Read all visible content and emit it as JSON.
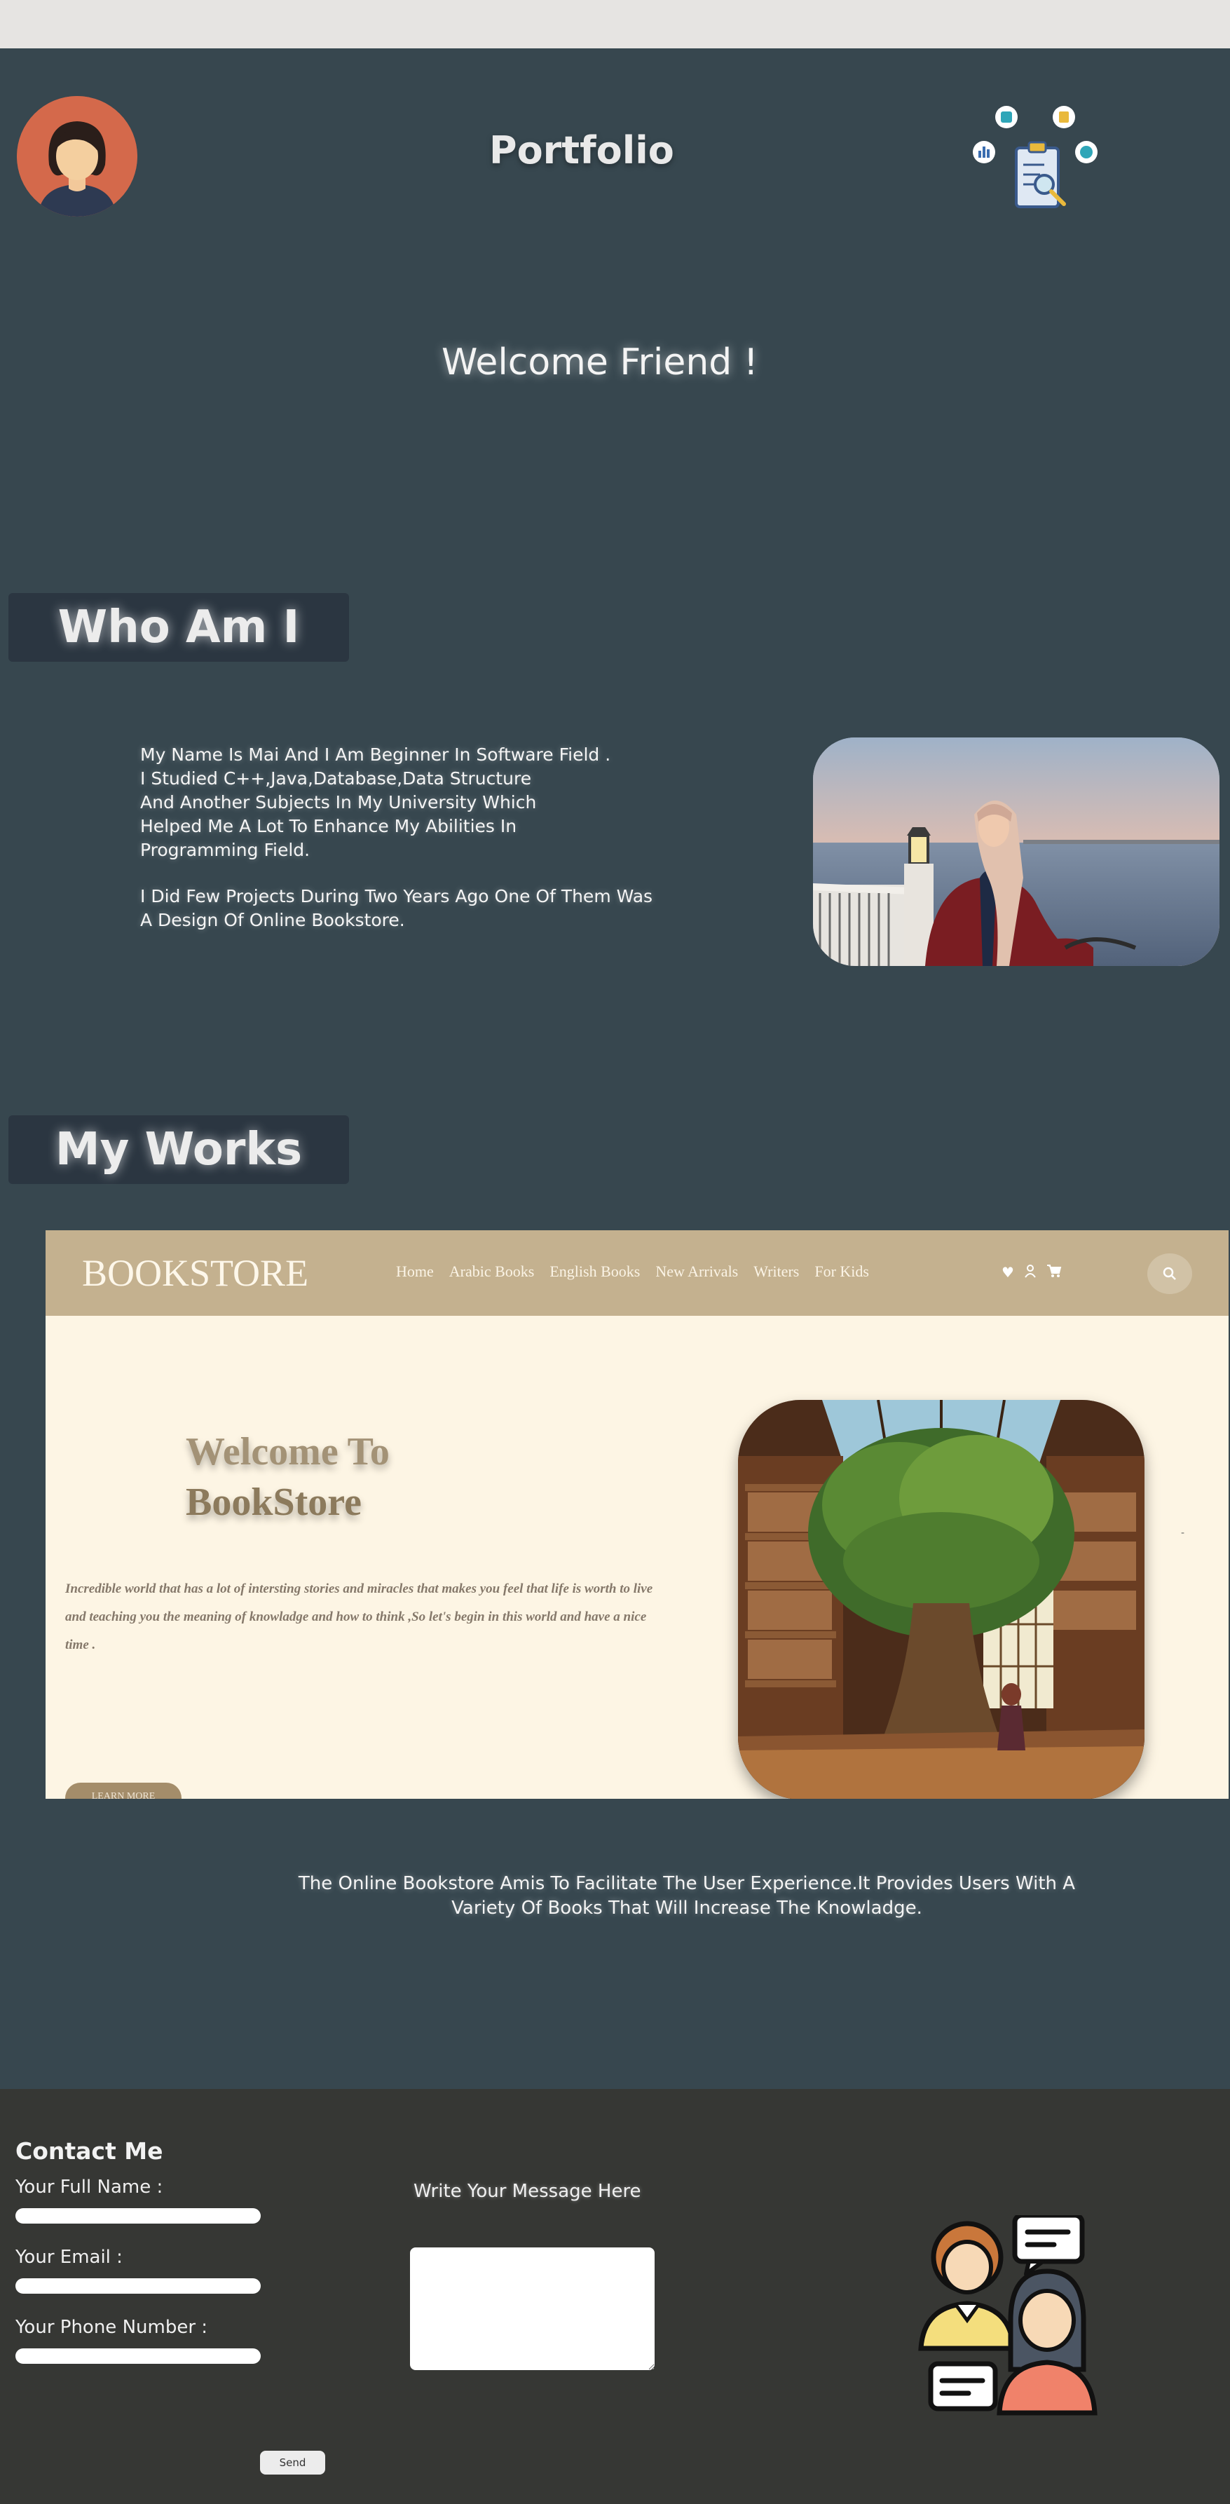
{
  "header": {
    "title": "Portfolio"
  },
  "hero": {
    "welcome": "Welcome Friend !"
  },
  "about": {
    "heading": "Who Am I",
    "paragraph1": "My Name Is Mai And I Am Beginner In Software Field .\nI Studied C++,Java,Database,Data Structure\nAnd Another Subjects In My University Which\nHelped Me A Lot To Enhance My Abilities In\nProgramming Field.",
    "paragraph2": "I Did Few Projects During Two Years Ago One Of Them Was\nA Design Of Online Bookstore."
  },
  "works": {
    "heading": "My Works",
    "bookstore": {
      "logo": "BOOKSTORE",
      "nav": [
        "Home",
        "Arabic Books",
        "English Books",
        "New Arrivals",
        "Writers",
        "For Kids"
      ],
      "title_line1": "Welcome To",
      "title_line2": "BookStore",
      "description": "Incredible world that has a lot of intersting stories and miracles that makes you feel that life is worth to live and teaching you the meaning of knowladge and how to think ,So let's begin in this world and have a nice time .",
      "learn_more": "LEARN MORE",
      "icons": [
        "heart-icon",
        "user-icon",
        "cart-icon",
        "search-icon"
      ]
    },
    "description": "The Online Bookstore Amis To Facilitate The User Experience.It Provides Users With A Variety Of Books That Will Increase The Knowladge."
  },
  "contact": {
    "title": "Contact Me",
    "name_label": "Your Full Name :",
    "email_label": "Your Email :",
    "phone_label": "Your Phone Number :",
    "message_label": "Write Your Message Here",
    "send_label": "Send"
  },
  "colors": {
    "page_bg": "#37474f",
    "footer_bg": "#363734",
    "badge_bg": "#2b3641",
    "bookstore_nav": "#c4b18f",
    "bookstore_bg": "#fdf5e4"
  }
}
